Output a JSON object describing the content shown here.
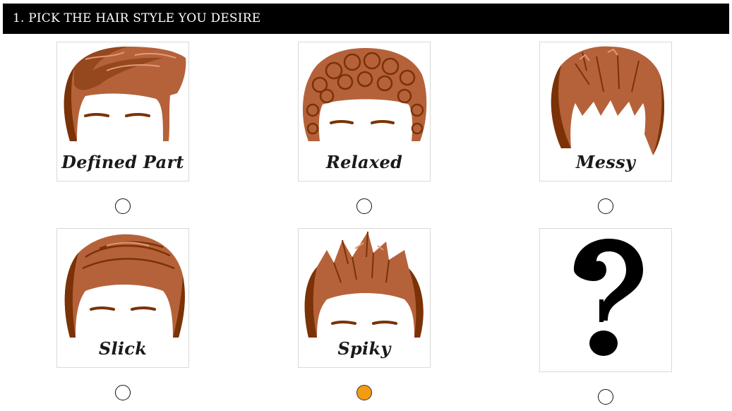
{
  "header": {
    "title": "1. PICK THE HAIR STYLE YOU DESIRE"
  },
  "options": [
    {
      "label": "Defined Part",
      "icon": "defined-part-hair-icon",
      "selected": false
    },
    {
      "label": "Relaxed",
      "icon": "relaxed-hair-icon",
      "selected": false
    },
    {
      "label": "Messy",
      "icon": "messy-hair-icon",
      "selected": false
    },
    {
      "label": "Slick",
      "icon": "slick-hair-icon",
      "selected": false
    },
    {
      "label": "Spiky",
      "icon": "spiky-hair-icon",
      "selected": true
    },
    {
      "label": "",
      "icon": "question-mark-icon",
      "selected": false
    }
  ],
  "colors": {
    "hair": "#b5623a",
    "hair_dark": "#7a3206",
    "selected_radio": "#f39c12"
  }
}
